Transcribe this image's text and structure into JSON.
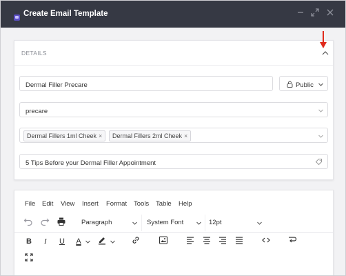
{
  "window": {
    "title": "Create Email Template",
    "controls": [
      "minimize",
      "maximize",
      "close"
    ]
  },
  "details": {
    "section_label": "DETAILS",
    "template_name": "Dermal Filler Precare",
    "visibility": "Public",
    "category": "precare",
    "tags": [
      {
        "label": "Dermal Fillers 1ml Cheek",
        "remove": "×"
      },
      {
        "label": "Dermal Fillers 2ml Cheek",
        "remove": "×"
      }
    ],
    "subject": "5 Tips Before your Dermal Filler Appointment"
  },
  "editor": {
    "menu": [
      "File",
      "Edit",
      "View",
      "Insert",
      "Format",
      "Tools",
      "Table",
      "Help"
    ],
    "block_format": "Paragraph",
    "font_family": "System Font",
    "font_size": "12pt",
    "buttons": {
      "bold": "B",
      "italic": "I",
      "underline": "U",
      "text_color": "A"
    }
  },
  "colors": {
    "titlebar": "#363944",
    "annotation_arrow": "#e02a1c",
    "accent_icon": "#5b4fc4"
  }
}
